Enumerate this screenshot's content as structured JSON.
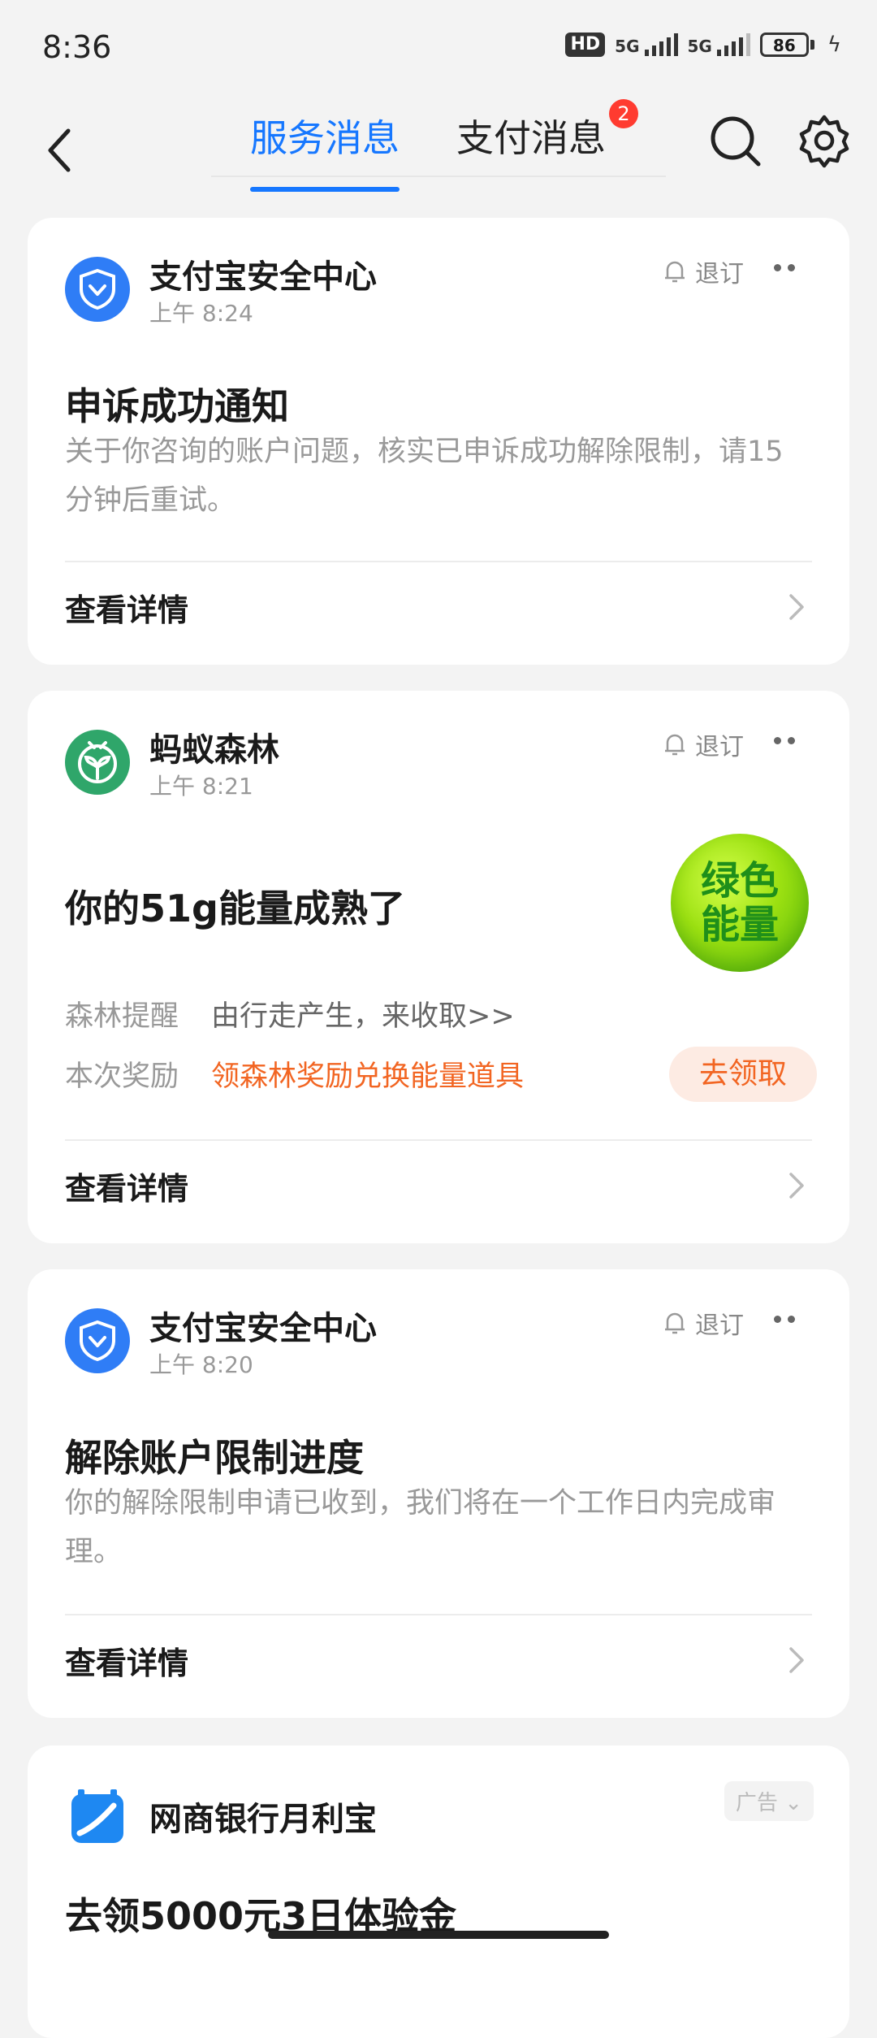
{
  "status_bar": {
    "time": "8:36",
    "hd": "HD",
    "signal1": "5G",
    "signal2": "5G",
    "battery": "86"
  },
  "header": {
    "tabs": [
      {
        "label": "服务消息",
        "active": true
      },
      {
        "label": "支付消息",
        "active": false,
        "badge": "2"
      }
    ],
    "accent_color": "#1677ff"
  },
  "cards": [
    {
      "sender": "支付宝安全中心",
      "time": "上午 8:24",
      "unsubscribe": "退订",
      "title": "申诉成功通知",
      "body": "关于你咨询的账户问题，核实已申诉成功解除限制，请15分钟后重试。",
      "details": "查看详情",
      "avatar_icon": "shield-icon"
    },
    {
      "sender": "蚂蚁森林",
      "time": "上午 8:21",
      "unsubscribe": "退订",
      "title": "你的51g能量成熟了",
      "orb_line1": "绿色",
      "orb_line2": "能量",
      "rows": [
        {
          "label": "森林提醒",
          "value": "由行走产生，来收取>>"
        },
        {
          "label": "本次奖励",
          "value": "领森林奖励兑换能量道具"
        }
      ],
      "claim_button": "去领取",
      "details": "查看详情",
      "avatar_icon": "sprout-icon"
    },
    {
      "sender": "支付宝安全中心",
      "time": "上午 8:20",
      "unsubscribe": "退订",
      "title": "解除账户限制进度",
      "body": "你的解除限制申请已收到，我们将在一个工作日内完成审理。",
      "details": "查看详情",
      "avatar_icon": "shield-icon"
    },
    {
      "sender": "网商银行月利宝",
      "ad_tag": "广告",
      "title": "去领5000元3日体验金",
      "avatar_icon": "bank-icon"
    }
  ]
}
